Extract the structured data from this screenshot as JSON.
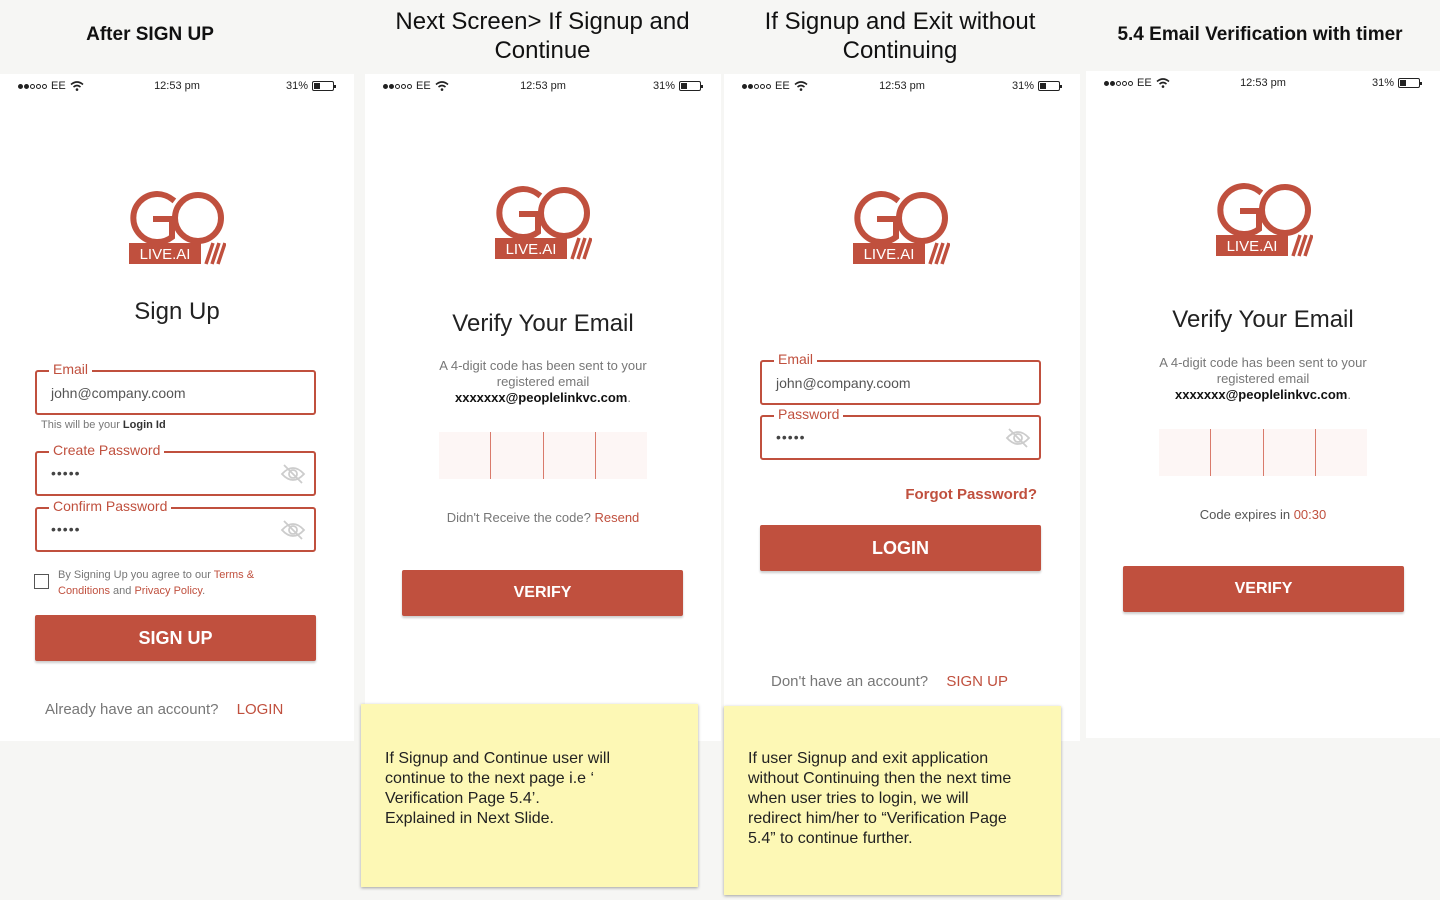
{
  "titles": [
    "After SIGN UP",
    "Next Screen> If Signup and Continue",
    "If Signup and Exit without Continuing",
    "5.4 Email Verification with timer"
  ],
  "status": {
    "carrier": "EE",
    "time": "12:53 pm",
    "battery": "31%"
  },
  "logo": {
    "text": "LIVE.AI"
  },
  "screen1": {
    "heading": "Sign Up",
    "email_label": "Email",
    "email_value": "john@company.coom",
    "email_hint_prefix": "This will be your ",
    "email_hint_bold": "Login Id",
    "create_label": "Create Password",
    "confirm_label": "Confirm Password",
    "password_mask": "•••••",
    "terms_text": "By Signing Up you agree to our ",
    "terms_link1": "Terms & Conditions",
    "terms_and": " and ",
    "terms_link2": "Privacy Policy",
    "terms_end": ".",
    "button": "SIGN UP",
    "footer_text": "Already have an account?",
    "footer_link": "LOGIN"
  },
  "screen2": {
    "heading": "Verify Your Email",
    "sub_line1": "A 4-digit code has been sent to your",
    "sub_line2": "registered email",
    "email": "xxxxxxx@peoplelinkvc.com",
    "resend_text": "Didn't Receive the code?",
    "resend_link": "Resend",
    "button": "VERIFY"
  },
  "screen3": {
    "email_label": "Email",
    "email_value": "john@company.coom",
    "password_label": "Password",
    "password_mask": "•••••",
    "forgot": "Forgot Password?",
    "button": "LOGIN",
    "footer_text": "Don't have an account?",
    "footer_link": "SIGN UP"
  },
  "screen4": {
    "heading": "Verify Your Email",
    "sub_line1": "A 4-digit code has been sent to your",
    "sub_line2": "registered email",
    "email": "xxxxxxx@peoplelinkvc.com",
    "timer_text": "Code expires in",
    "timer_value": "00:30",
    "button": "VERIFY"
  },
  "notes": {
    "note1": [
      "If Signup and Continue user will",
      "continue to the next page i.e ‘",
      "Verification Page 5.4’.",
      "Explained in Next Slide."
    ],
    "note2": [
      "If user Signup and exit application",
      "without Continuing then the next time",
      "when user tries to login, we will",
      "redirect him/her to “Verification Page",
      "5.4” to continue further."
    ]
  },
  "colors": {
    "accent": "#c0503e",
    "note": "#fdf8b5"
  },
  "icons": [
    "wifi-icon",
    "battery-icon",
    "eye-slash-icon",
    "checkbox-icon",
    "golive-logo"
  ]
}
